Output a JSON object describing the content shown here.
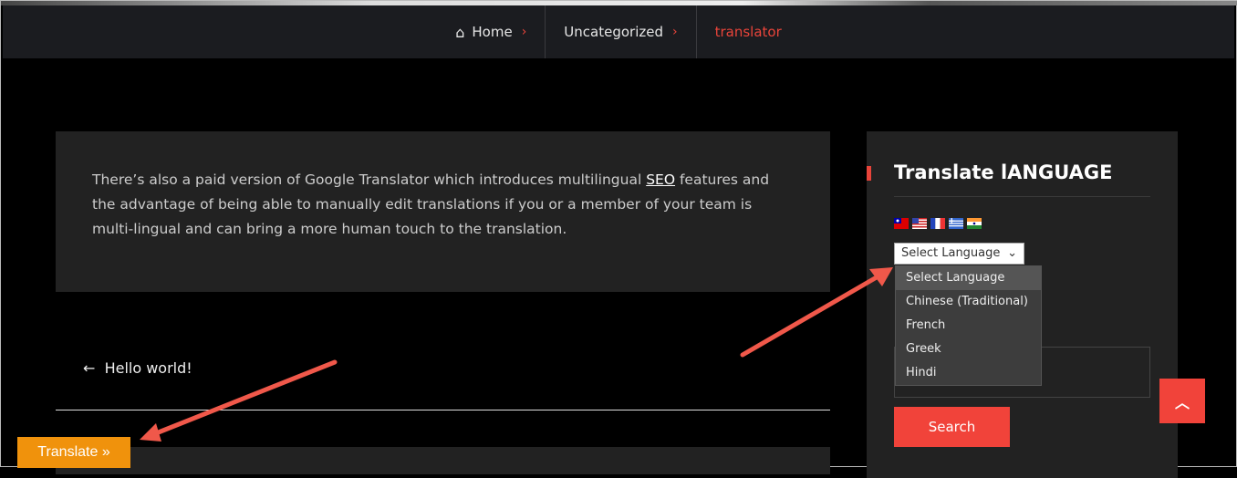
{
  "breadcrumb": {
    "items": [
      {
        "label": "Home",
        "icon": "home-icon"
      },
      {
        "label": "Uncategorized"
      }
    ],
    "current": "translator",
    "separator": "›"
  },
  "content": {
    "text_before": "There’s also a paid version of Google Translator which introduces multilingual ",
    "link": "SEO",
    "text_after": " features and the advantage of being able to manually edit translations if you or a member of your team is multi-lingual and can bring a more human touch to the translation."
  },
  "post_nav": {
    "prev_arrow": "←",
    "prev_label": "Hello world!"
  },
  "sidebar": {
    "title": "Translate lANGUAGE",
    "flags": [
      "taiwan-flag",
      "usa-flag",
      "france-flag",
      "greece-flag",
      "india-flag"
    ],
    "select": {
      "value": "Select Language",
      "options": [
        "Select Language",
        "Chinese (Traditional)",
        "French",
        "Greek",
        "Hindi"
      ]
    },
    "search_label": "Search"
  },
  "translate_button": "Translate »",
  "scroll_top_icon": "chevron-up-icon",
  "colors": {
    "accent": "#f1433a",
    "translate": "#f0920c",
    "arrow": "#f0584a"
  }
}
